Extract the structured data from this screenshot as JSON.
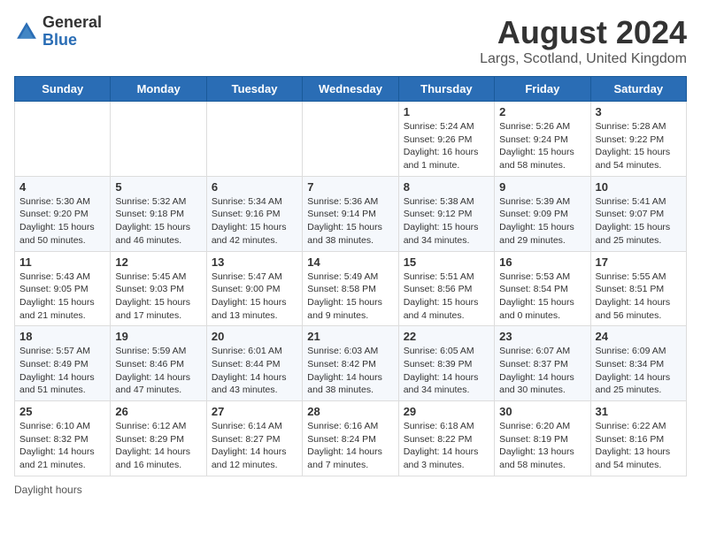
{
  "header": {
    "logo_general": "General",
    "logo_blue": "Blue",
    "month_year": "August 2024",
    "location": "Largs, Scotland, United Kingdom"
  },
  "weekdays": [
    "Sunday",
    "Monday",
    "Tuesday",
    "Wednesday",
    "Thursday",
    "Friday",
    "Saturday"
  ],
  "weeks": [
    [
      {
        "day": "",
        "info": ""
      },
      {
        "day": "",
        "info": ""
      },
      {
        "day": "",
        "info": ""
      },
      {
        "day": "",
        "info": ""
      },
      {
        "day": "1",
        "info": "Sunrise: 5:24 AM\nSunset: 9:26 PM\nDaylight: 16 hours and 1 minute."
      },
      {
        "day": "2",
        "info": "Sunrise: 5:26 AM\nSunset: 9:24 PM\nDaylight: 15 hours and 58 minutes."
      },
      {
        "day": "3",
        "info": "Sunrise: 5:28 AM\nSunset: 9:22 PM\nDaylight: 15 hours and 54 minutes."
      }
    ],
    [
      {
        "day": "4",
        "info": "Sunrise: 5:30 AM\nSunset: 9:20 PM\nDaylight: 15 hours and 50 minutes."
      },
      {
        "day": "5",
        "info": "Sunrise: 5:32 AM\nSunset: 9:18 PM\nDaylight: 15 hours and 46 minutes."
      },
      {
        "day": "6",
        "info": "Sunrise: 5:34 AM\nSunset: 9:16 PM\nDaylight: 15 hours and 42 minutes."
      },
      {
        "day": "7",
        "info": "Sunrise: 5:36 AM\nSunset: 9:14 PM\nDaylight: 15 hours and 38 minutes."
      },
      {
        "day": "8",
        "info": "Sunrise: 5:38 AM\nSunset: 9:12 PM\nDaylight: 15 hours and 34 minutes."
      },
      {
        "day": "9",
        "info": "Sunrise: 5:39 AM\nSunset: 9:09 PM\nDaylight: 15 hours and 29 minutes."
      },
      {
        "day": "10",
        "info": "Sunrise: 5:41 AM\nSunset: 9:07 PM\nDaylight: 15 hours and 25 minutes."
      }
    ],
    [
      {
        "day": "11",
        "info": "Sunrise: 5:43 AM\nSunset: 9:05 PM\nDaylight: 15 hours and 21 minutes."
      },
      {
        "day": "12",
        "info": "Sunrise: 5:45 AM\nSunset: 9:03 PM\nDaylight: 15 hours and 17 minutes."
      },
      {
        "day": "13",
        "info": "Sunrise: 5:47 AM\nSunset: 9:00 PM\nDaylight: 15 hours and 13 minutes."
      },
      {
        "day": "14",
        "info": "Sunrise: 5:49 AM\nSunset: 8:58 PM\nDaylight: 15 hours and 9 minutes."
      },
      {
        "day": "15",
        "info": "Sunrise: 5:51 AM\nSunset: 8:56 PM\nDaylight: 15 hours and 4 minutes."
      },
      {
        "day": "16",
        "info": "Sunrise: 5:53 AM\nSunset: 8:54 PM\nDaylight: 15 hours and 0 minutes."
      },
      {
        "day": "17",
        "info": "Sunrise: 5:55 AM\nSunset: 8:51 PM\nDaylight: 14 hours and 56 minutes."
      }
    ],
    [
      {
        "day": "18",
        "info": "Sunrise: 5:57 AM\nSunset: 8:49 PM\nDaylight: 14 hours and 51 minutes."
      },
      {
        "day": "19",
        "info": "Sunrise: 5:59 AM\nSunset: 8:46 PM\nDaylight: 14 hours and 47 minutes."
      },
      {
        "day": "20",
        "info": "Sunrise: 6:01 AM\nSunset: 8:44 PM\nDaylight: 14 hours and 43 minutes."
      },
      {
        "day": "21",
        "info": "Sunrise: 6:03 AM\nSunset: 8:42 PM\nDaylight: 14 hours and 38 minutes."
      },
      {
        "day": "22",
        "info": "Sunrise: 6:05 AM\nSunset: 8:39 PM\nDaylight: 14 hours and 34 minutes."
      },
      {
        "day": "23",
        "info": "Sunrise: 6:07 AM\nSunset: 8:37 PM\nDaylight: 14 hours and 30 minutes."
      },
      {
        "day": "24",
        "info": "Sunrise: 6:09 AM\nSunset: 8:34 PM\nDaylight: 14 hours and 25 minutes."
      }
    ],
    [
      {
        "day": "25",
        "info": "Sunrise: 6:10 AM\nSunset: 8:32 PM\nDaylight: 14 hours and 21 minutes."
      },
      {
        "day": "26",
        "info": "Sunrise: 6:12 AM\nSunset: 8:29 PM\nDaylight: 14 hours and 16 minutes."
      },
      {
        "day": "27",
        "info": "Sunrise: 6:14 AM\nSunset: 8:27 PM\nDaylight: 14 hours and 12 minutes."
      },
      {
        "day": "28",
        "info": "Sunrise: 6:16 AM\nSunset: 8:24 PM\nDaylight: 14 hours and 7 minutes."
      },
      {
        "day": "29",
        "info": "Sunrise: 6:18 AM\nSunset: 8:22 PM\nDaylight: 14 hours and 3 minutes."
      },
      {
        "day": "30",
        "info": "Sunrise: 6:20 AM\nSunset: 8:19 PM\nDaylight: 13 hours and 58 minutes."
      },
      {
        "day": "31",
        "info": "Sunrise: 6:22 AM\nSunset: 8:16 PM\nDaylight: 13 hours and 54 minutes."
      }
    ]
  ],
  "footer": {
    "note": "Daylight hours"
  }
}
